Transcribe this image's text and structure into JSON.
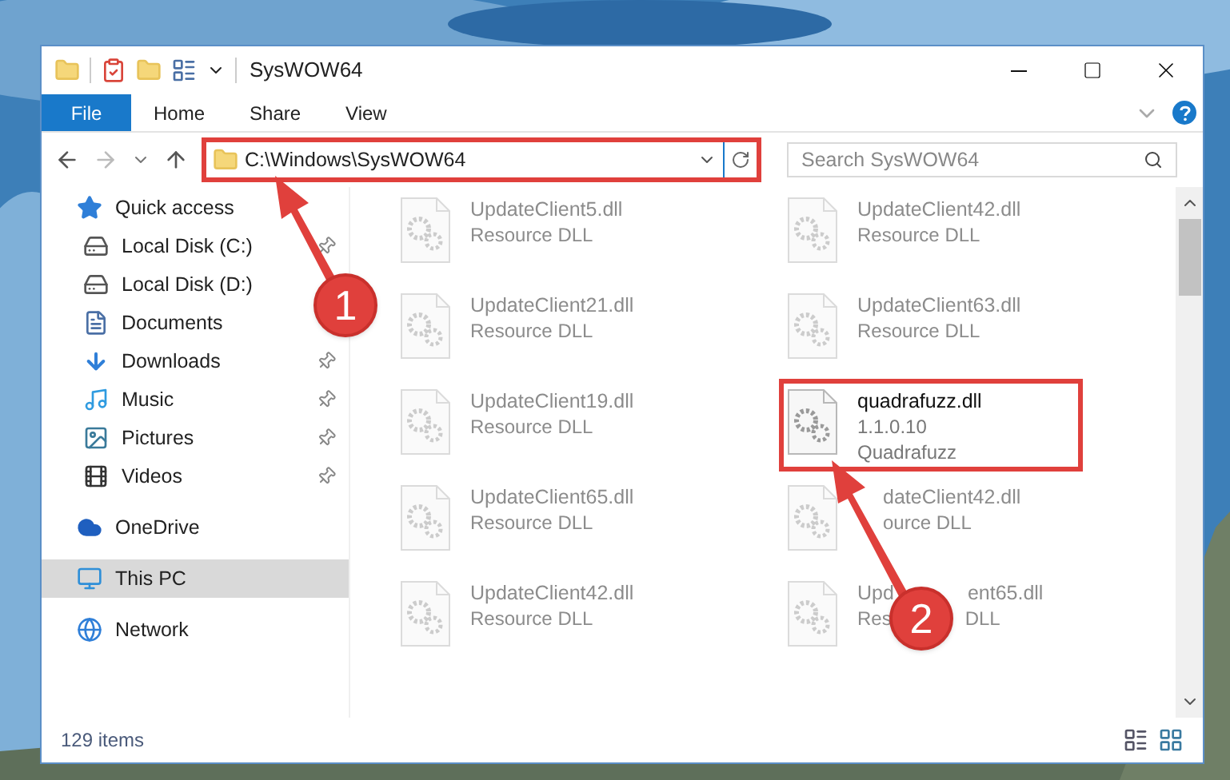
{
  "window": {
    "title": "SysWOW64"
  },
  "ribbon_tabs": [
    {
      "label": "File",
      "kind": "file"
    },
    {
      "label": "Home",
      "kind": "tab"
    },
    {
      "label": "Share",
      "kind": "tab"
    },
    {
      "label": "View",
      "kind": "tab"
    }
  ],
  "address": {
    "path": "C:\\Windows\\SysWOW64",
    "highlighted": true
  },
  "search": {
    "placeholder": "Search SysWOW64"
  },
  "sidebar": [
    {
      "label": "Quick access",
      "kind": "quick",
      "selected": false,
      "children": [
        {
          "label": "Local Disk (C:)",
          "kind": "drive-c",
          "pinned": true
        },
        {
          "label": "Local Disk (D:)",
          "kind": "drive",
          "pinned": false
        },
        {
          "label": "Documents",
          "kind": "documents",
          "pinned": false
        },
        {
          "label": "Downloads",
          "kind": "downloads",
          "pinned": true
        },
        {
          "label": "Music",
          "kind": "music",
          "pinned": true
        },
        {
          "label": "Pictures",
          "kind": "pictures",
          "pinned": true
        },
        {
          "label": "Videos",
          "kind": "videos",
          "pinned": true
        }
      ]
    },
    {
      "label": "OneDrive",
      "kind": "cloud",
      "selected": false
    },
    {
      "label": "This PC",
      "kind": "pc",
      "selected": true
    },
    {
      "label": "Network",
      "kind": "network",
      "selected": false
    }
  ],
  "files": [
    {
      "name": [
        "UpdateClient5.dll"
      ],
      "details": [
        [
          "Resource DLL"
        ]
      ],
      "dimmed": true,
      "kind": "plain",
      "highlighted": false
    },
    {
      "name": [
        "UpdateClient42.dll"
      ],
      "details": [
        [
          "Resource DLL"
        ]
      ],
      "dimmed": true,
      "kind": "plain",
      "highlighted": false
    },
    {
      "name": [
        "UpdateClient21.dll"
      ],
      "details": [
        [
          "Resource DLL"
        ]
      ],
      "dimmed": true,
      "kind": "plain",
      "highlighted": false
    },
    {
      "name": [
        "UpdateClient63.dll"
      ],
      "details": [
        [
          "Resource DLL"
        ]
      ],
      "dimmed": true,
      "kind": "plain",
      "highlighted": false
    },
    {
      "name": [
        "UpdateClient19.dll"
      ],
      "details": [
        [
          "Resource DLL"
        ]
      ],
      "dimmed": true,
      "kind": "plain",
      "highlighted": false
    },
    {
      "name": [
        "quadrafuzz.dll"
      ],
      "details": [
        [
          "1.1.0.10"
        ],
        [
          "Quadrafuzz"
        ]
      ],
      "dimmed": false,
      "kind": "plain",
      "highlighted": true
    },
    {
      "name": [
        "UpdateClient65.dll"
      ],
      "details": [
        [
          "Resource DLL"
        ]
      ],
      "dimmed": true,
      "kind": "plain",
      "highlighted": false
    },
    {
      "name": [
        "dateClient42.dll"
      ],
      "details": [
        [
          "ource DLL"
        ]
      ],
      "dimmed": true,
      "kind": "covered-start",
      "highlighted": false
    },
    {
      "name": [
        "UpdateClient42.dll"
      ],
      "details": [
        [
          "Resource DLL"
        ]
      ],
      "dimmed": true,
      "kind": "plain",
      "highlighted": false
    },
    {
      "name": [
        "Upd",
        "ent65.dll"
      ],
      "details": [
        [
          "Res",
          "DLL"
        ]
      ],
      "dimmed": true,
      "kind": "covered-middle",
      "highlighted": false
    }
  ],
  "status_bar": {
    "count": "129 items"
  },
  "annotations": [
    {
      "label": "1"
    },
    {
      "label": "2"
    }
  ]
}
